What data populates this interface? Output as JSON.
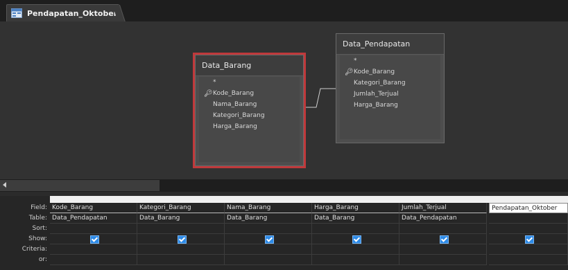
{
  "tab": {
    "title": "Pendapatan_Oktober",
    "icon": "query-icon"
  },
  "tables": {
    "data_barang": {
      "title": "Data_Barang",
      "all_fields": "*",
      "fields": [
        "Kode_Barang",
        "Nama_Barang",
        "Kategori_Barang",
        "Harga_Barang"
      ],
      "primary_key": "Kode_Barang"
    },
    "data_pendapatan": {
      "title": "Data_Pendapatan",
      "all_fields": "*",
      "fields": [
        "Kode_Barang",
        "Kategori_Barang",
        "Jumlah_Terjual",
        "Harga_Barang"
      ],
      "primary_key": "Kode_Barang"
    }
  },
  "grid": {
    "row_labels": [
      "Field:",
      "Table:",
      "Sort:",
      "Show:",
      "Criteria:",
      "or:"
    ],
    "columns": [
      {
        "field": "Kode_Barang",
        "table": "Data_Pendapatan",
        "show": true
      },
      {
        "field": "Kategori_Barang",
        "table": "Data_Barang",
        "show": true
      },
      {
        "field": "Nama_Barang",
        "table": "Data_Barang",
        "show": true
      },
      {
        "field": "Harga_Barang",
        "table": "Data_Barang",
        "show": true
      },
      {
        "field": "Jumlah_Terjual",
        "table": "Data_Pendapatan",
        "show": true
      },
      {
        "field": "Pendapatan_Oktober",
        "table": "",
        "show": true
      }
    ]
  },
  "colors": {
    "selected_outline": "#c0393b",
    "checkbox": "#2e8ae6"
  }
}
